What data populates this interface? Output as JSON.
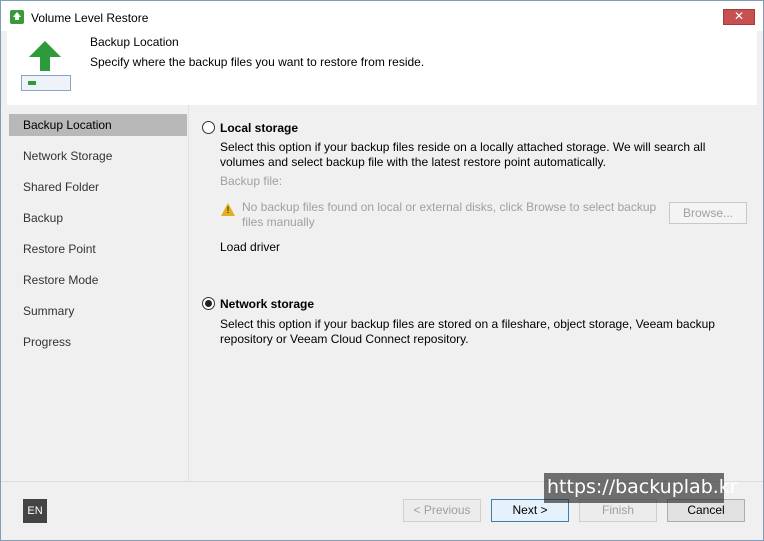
{
  "window": {
    "title": "Volume Level Restore",
    "close_label": "✕"
  },
  "header": {
    "title": "Backup Location",
    "subtitle": "Specify where the backup files you want to restore from reside."
  },
  "nav": {
    "items": [
      {
        "label": "Backup Location",
        "active": true
      },
      {
        "label": "Network Storage"
      },
      {
        "label": "Shared Folder"
      },
      {
        "label": "Backup"
      },
      {
        "label": "Restore Point"
      },
      {
        "label": "Restore Mode"
      },
      {
        "label": "Summary"
      },
      {
        "label": "Progress"
      }
    ]
  },
  "local": {
    "label": "Local storage",
    "description": "Select this option if your backup files reside on a locally attached storage. We will search all volumes and select backup file with the latest restore point automatically.",
    "backup_file_label": "Backup file:",
    "warning": "No backup files found on local or external disks, click Browse to select backup files manually",
    "browse_label": "Browse...",
    "load_driver": "Load driver"
  },
  "network": {
    "label": "Network storage",
    "description": "Select this option if your backup files are stored on a fileshare, object storage, Veeam backup repository or Veeam Cloud Connect repository."
  },
  "footer": {
    "lang": "EN",
    "previous": "< Previous",
    "next": "Next >",
    "finish": "Finish",
    "cancel": "Cancel"
  },
  "watermark": "https://backuplab.kr",
  "colors": {
    "accent_green": "#2d9a3b",
    "nav_active": "#b8b8b8",
    "close_red": "#c75050"
  }
}
